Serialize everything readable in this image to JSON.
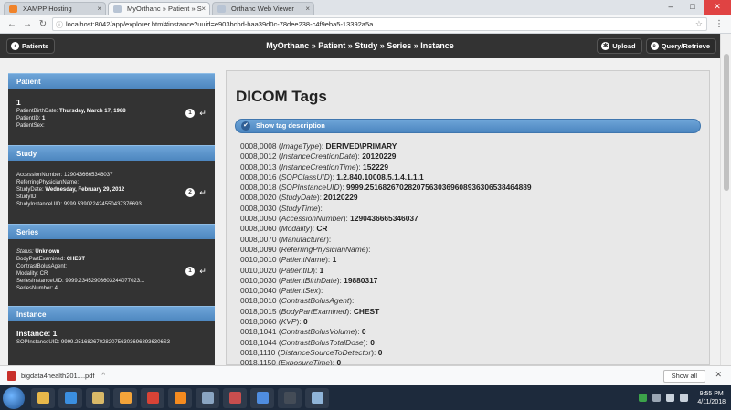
{
  "browser": {
    "tabs": [
      {
        "label": "XAMPP Hosting",
        "favicon_color": "#f0832a",
        "active": false
      },
      {
        "label": "MyOrthanc » Patient » S",
        "favicon_color": "#b8c4d4",
        "active": true
      },
      {
        "label": "Orthanc Web Viewer",
        "favicon_color": "#b8c4d4",
        "active": false
      }
    ],
    "url": "localhost:8042/app/explorer.html#instance?uuid=e903bcbd-baa39d0c-78dee238-c4f9eba5-13392a5a"
  },
  "header": {
    "patients_button": "Patients",
    "breadcrumb": "MyOrthanc » Patient » Study » Series » Instance",
    "upload_button": "Upload",
    "query_button": "Query/Retrieve"
  },
  "sidebar": {
    "patient": {
      "title": "Patient",
      "name": "1",
      "lines": [
        {
          "k": "PatientBirthDate: ",
          "v": "Thursday, March 17, 1988"
        },
        {
          "k": "PatientID: ",
          "v": "1"
        },
        {
          "k": "PatientSex:",
          "v": ""
        }
      ],
      "count": "1"
    },
    "study": {
      "title": "Study",
      "lines": [
        {
          "k": "AccessionNumber: 1290436665346037",
          "v": ""
        },
        {
          "k": "ReferringPhysicianName:",
          "v": ""
        },
        {
          "k": "StudyDate: ",
          "v": "Wednesday, February 29, 2012"
        },
        {
          "k": "StudyID:",
          "v": ""
        },
        {
          "k": "StudyInstanceUID: 9999.539022424550437376693...",
          "v": ""
        }
      ],
      "count": "2"
    },
    "series": {
      "title": "Series",
      "lines": [
        {
          "k": "Status: ",
          "v": "Unknown"
        },
        {
          "k": "BodyPartExamined: ",
          "v": "CHEST"
        },
        {
          "k": "ContrastBolusAgent:",
          "v": ""
        },
        {
          "k": "Modality: CR",
          "v": ""
        },
        {
          "k": "SeriesInstanceUID: 9999.23452903603244077023...",
          "v": ""
        },
        {
          "k": "SeriesNumber: 4",
          "v": ""
        }
      ],
      "count": "1"
    },
    "instance": {
      "title": "Instance",
      "name": "Instance: 1",
      "uid": "SOPInstanceUID: 9999.25168267028207563036968936306S3"
    }
  },
  "content": {
    "title": "DICOM Tags",
    "show_desc": "Show tag description",
    "tags": [
      {
        "code": "0008,0008",
        "name": "ImageType",
        "value": "DERIVED\\PRIMARY"
      },
      {
        "code": "0008,0012",
        "name": "InstanceCreationDate",
        "value": "20120229"
      },
      {
        "code": "0008,0013",
        "name": "InstanceCreationTime",
        "value": "152229"
      },
      {
        "code": "0008,0016",
        "name": "SOPClassUID",
        "value": "1.2.840.10008.5.1.4.1.1.1"
      },
      {
        "code": "0008,0018",
        "name": "SOPInstanceUID",
        "value": "9999.251682670282075630369608936306538464889"
      },
      {
        "code": "0008,0020",
        "name": "StudyDate",
        "value": "20120229"
      },
      {
        "code": "0008,0030",
        "name": "StudyTime",
        "value": ""
      },
      {
        "code": "0008,0050",
        "name": "AccessionNumber",
        "value": "1290436665346037"
      },
      {
        "code": "0008,0060",
        "name": "Modality",
        "value": "CR"
      },
      {
        "code": "0008,0070",
        "name": "Manufacturer",
        "value": ""
      },
      {
        "code": "0008,0090",
        "name": "ReferringPhysicianName",
        "value": ""
      },
      {
        "code": "0010,0010",
        "name": "PatientName",
        "value": "1"
      },
      {
        "code": "0010,0020",
        "name": "PatientID",
        "value": "1"
      },
      {
        "code": "0010,0030",
        "name": "PatientBirthDate",
        "value": "19880317"
      },
      {
        "code": "0010,0040",
        "name": "PatientSex",
        "value": ""
      },
      {
        "code": "0018,0010",
        "name": "ContrastBolusAgent",
        "value": ""
      },
      {
        "code": "0018,0015",
        "name": "BodyPartExamined",
        "value": "CHEST"
      },
      {
        "code": "0018,0060",
        "name": "KVP",
        "value": "0"
      },
      {
        "code": "0018,1041",
        "name": "ContrastBolusVolume",
        "value": "0"
      },
      {
        "code": "0018,1044",
        "name": "ContrastBolusTotalDose",
        "value": "0"
      },
      {
        "code": "0018,1110",
        "name": "DistanceSourceToDetector",
        "value": "0"
      },
      {
        "code": "0018,1150",
        "name": "ExposureTime",
        "value": "0"
      }
    ]
  },
  "downloads": {
    "file": "bigdata4health201....pdf",
    "show_all": "Show all"
  },
  "taskbar": {
    "time": "9:55 PM",
    "date": "4/11/2018",
    "apps": [
      {
        "icon": "explorer-icon",
        "color": "#e8b84a"
      },
      {
        "icon": "ie-icon",
        "color": "#3b8fe0"
      },
      {
        "icon": "folder-icon",
        "color": "#d9b968"
      },
      {
        "icon": "media-icon",
        "color": "#f3a43a"
      },
      {
        "icon": "app-red-icon",
        "color": "#d84336"
      },
      {
        "icon": "sublime-icon",
        "color": "#f58b1f"
      },
      {
        "icon": "window-icon",
        "color": "#8aa5c2"
      },
      {
        "icon": "image-icon",
        "color": "#c84e4e"
      },
      {
        "icon": "chrome-icon",
        "color": "#4f8de0"
      },
      {
        "icon": "terminal-icon",
        "color": "#444c57"
      },
      {
        "icon": "photo-icon",
        "color": "#8fb4d8"
      }
    ]
  }
}
